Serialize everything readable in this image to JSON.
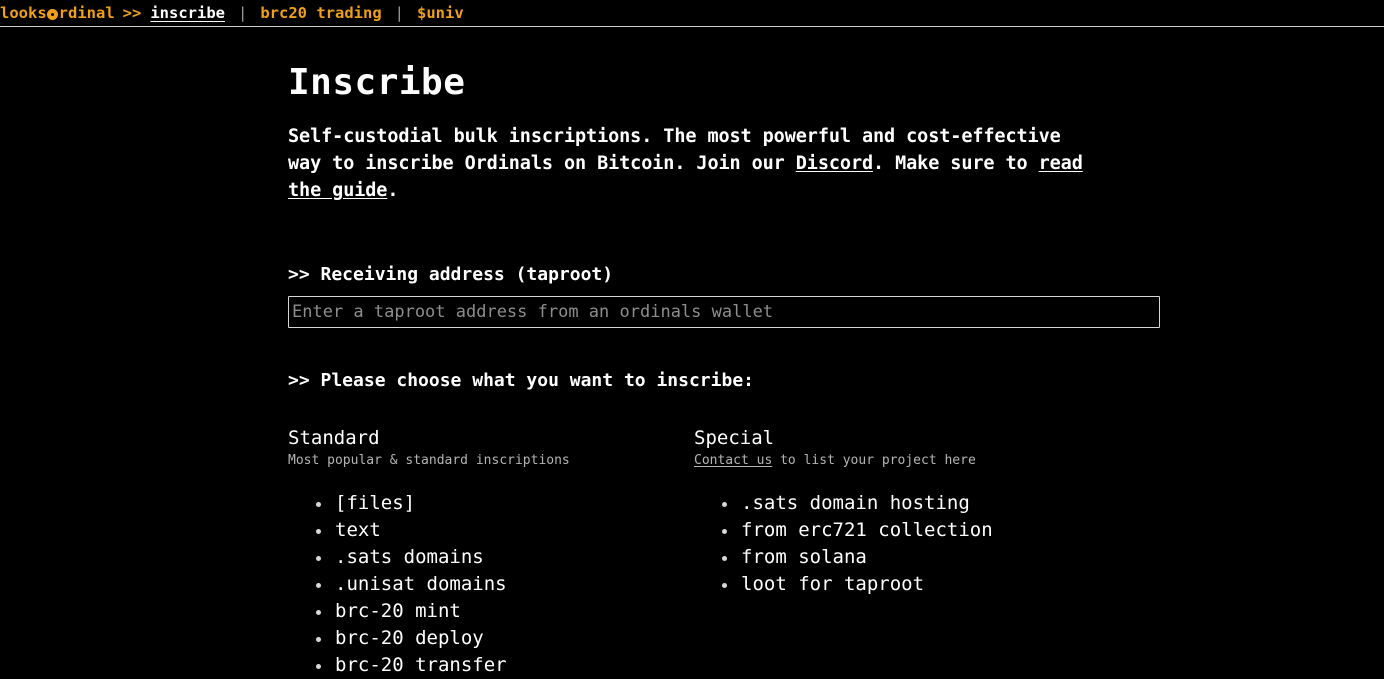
{
  "nav": {
    "brand_prefix": "looks",
    "brand_dot_icon": "coin-dot-icon",
    "brand_suffix": "rdinal",
    "arrow": ">>",
    "separator": "|",
    "items": [
      {
        "label": "inscribe",
        "active": true
      },
      {
        "label": "brc20 trading",
        "active": false
      },
      {
        "label": "$univ",
        "active": false
      }
    ]
  },
  "main": {
    "title": "Inscribe",
    "lede": {
      "part1": "Self-custodial bulk inscriptions. The most powerful and cost-effective way to inscribe Ordinals on Bitcoin. Join our ",
      "link1": "Discord",
      "part2": ". Make sure to ",
      "link2": "read the guide",
      "part3": "."
    },
    "address_section": {
      "label": ">> Receiving address (taproot)",
      "input_value": "",
      "input_placeholder": "Enter a taproot address from an ordinals wallet"
    },
    "choose_label": ">> Please choose what you want to inscribe:",
    "columns": [
      {
        "title": "Standard",
        "subtitle_text": "Most popular & standard inscriptions",
        "subtitle_link": "",
        "subtitle_after": "",
        "items": [
          "[files]",
          "text",
          ".sats domains",
          ".unisat domains",
          "brc-20 mint",
          "brc-20 deploy",
          "brc-20 transfer"
        ]
      },
      {
        "title": "Special",
        "subtitle_text": "",
        "subtitle_link": "Contact us",
        "subtitle_after": " to list your project here",
        "items": [
          ".sats domain hosting",
          "from erc721 collection",
          "from solana",
          "loot for taproot"
        ]
      }
    ]
  },
  "colors": {
    "background": "#000000",
    "accent_orange": "#efa018",
    "text": "#ffffff",
    "muted": "#b4b4b4",
    "placeholder": "#8d8d8d",
    "border": "#d6d6d6"
  }
}
